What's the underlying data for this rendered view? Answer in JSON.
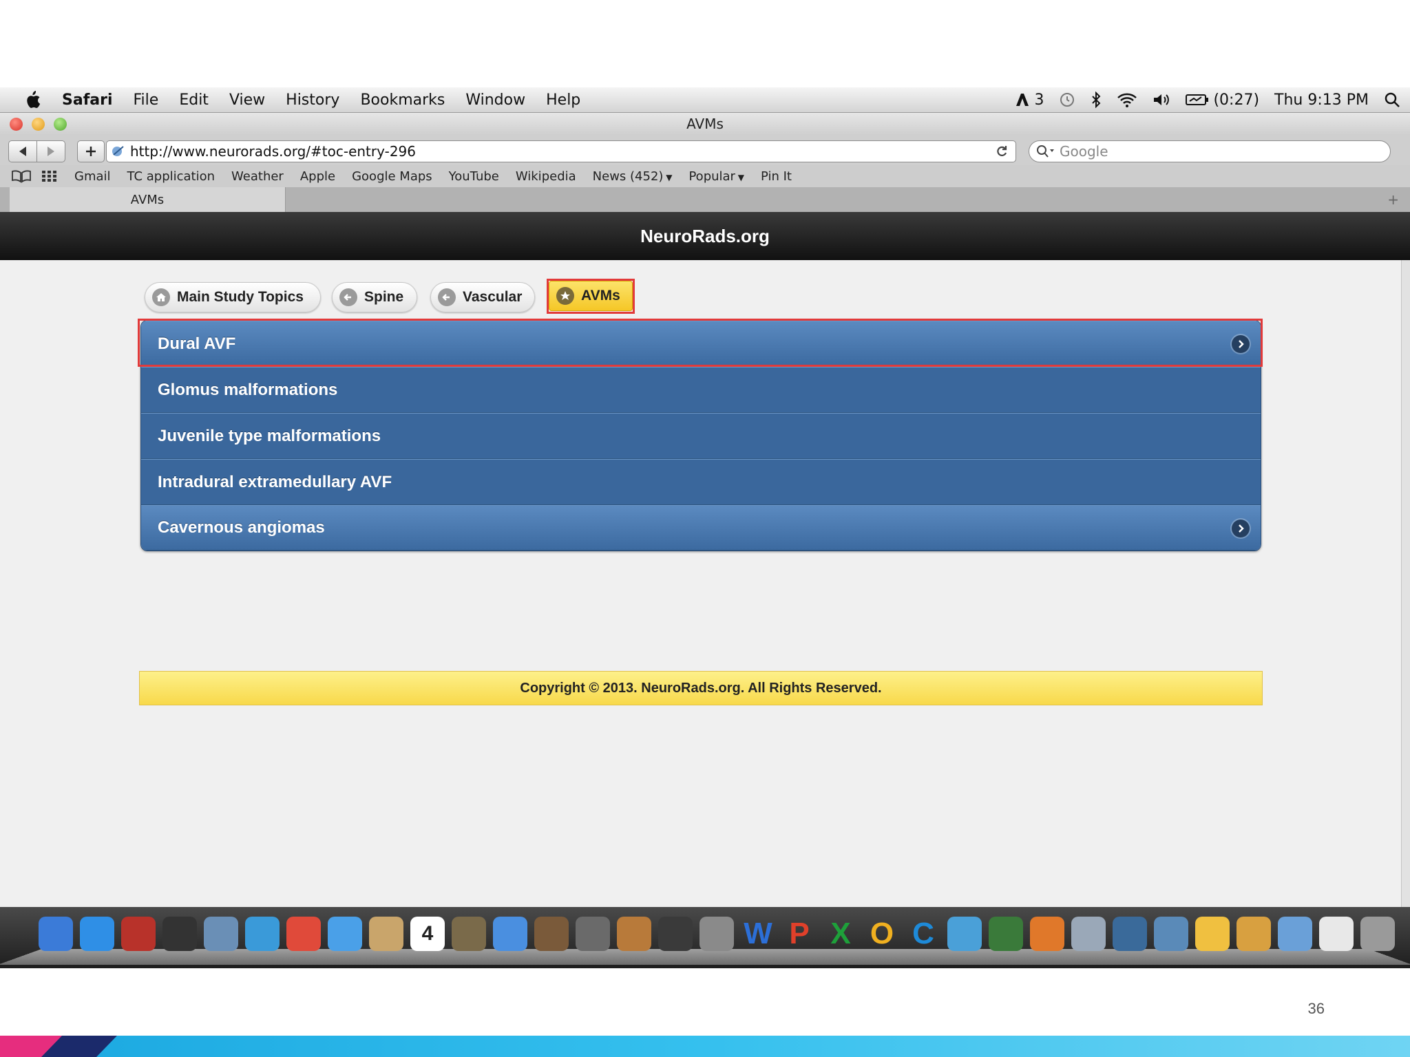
{
  "menubar": {
    "app": "Safari",
    "items": [
      "File",
      "Edit",
      "View",
      "History",
      "Bookmarks",
      "Window",
      "Help"
    ],
    "status": {
      "adobe_count": "3",
      "battery": "(0:27)",
      "clock": "Thu 9:13 PM"
    }
  },
  "window": {
    "title": "AVMs"
  },
  "toolbar": {
    "url": "http://www.neurorads.org/#toc-entry-296",
    "search_placeholder": "Google"
  },
  "bookmarks": [
    "Gmail",
    "TC application",
    "Weather",
    "Apple",
    "Google Maps",
    "YouTube",
    "Wikipedia",
    "News (452)",
    "Popular",
    "Pin It"
  ],
  "tab": {
    "label": "AVMs"
  },
  "site": {
    "title": "NeuroRads.org"
  },
  "breadcrumbs": [
    "Main Study Topics",
    "Spine",
    "Vascular",
    "AVMs"
  ],
  "list_items": [
    "Dural AVF",
    "Glomus malformations",
    "Juvenile type malformations",
    "Intradural extramedullary AVF",
    "Cavernous angiomas"
  ],
  "footer": {
    "copyright": "Copyright © 2013. NeuroRads.org. All Rights Reserved."
  },
  "slide": {
    "page_number": "36"
  },
  "colors": {
    "list_blue": "#3c6aa0",
    "active_yellow": "#f5c727",
    "highlight_red": "#e23a3a",
    "footer_yellow": "#f8d94b"
  },
  "dock_icons": [
    "finder-icon",
    "app-store-icon",
    "photo-booth-icon",
    "dashboard-icon",
    "preview-icon",
    "safari-icon",
    "chrome-icon",
    "messages-icon",
    "contacts-icon",
    "calendar-icon",
    "iphoto-icon",
    "itunes-icon",
    "image-capture-icon",
    "imovie-icon",
    "garageband-icon",
    "time-machine-icon",
    "system-preferences-icon",
    "word-icon",
    "powerpoint-icon",
    "excel-icon",
    "outlook-icon",
    "communicator-icon",
    "messenger-icon",
    "remote-desktop-icon",
    "firefox-icon",
    "utilities-icon",
    "hp-scan-icon",
    "hp-utility-icon",
    "idea-icon",
    "textedit-icon",
    "applications-folder-icon",
    "documents-icon",
    "trash-icon"
  ]
}
